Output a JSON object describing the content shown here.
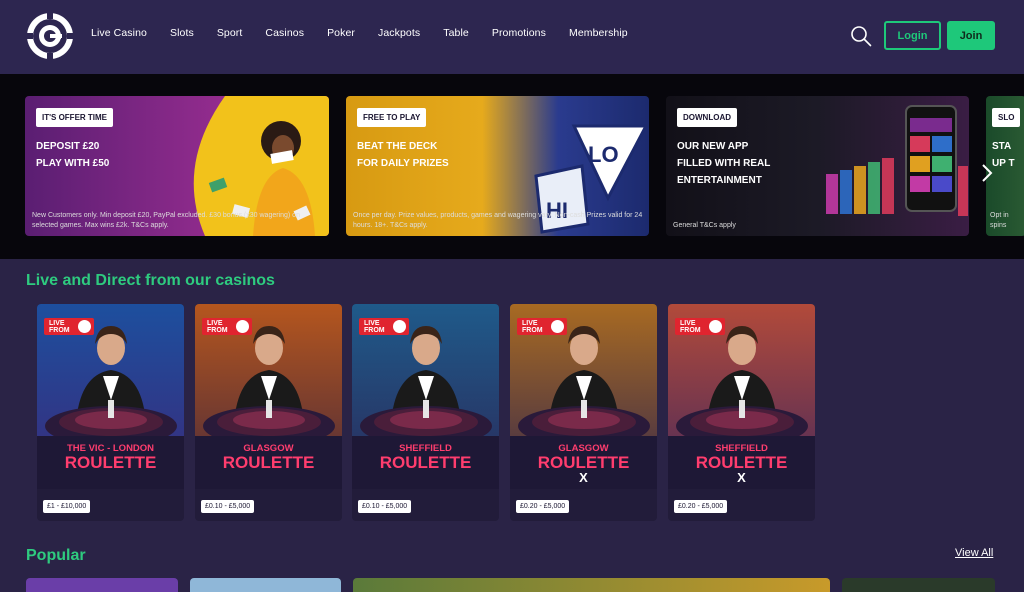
{
  "header": {
    "nav": [
      "Live Casino",
      "Slots",
      "Sport",
      "Casinos",
      "Poker",
      "Jackpots",
      "Table",
      "Promotions",
      "Membership"
    ],
    "login_label": "Login",
    "join_label": "Join",
    "accent": "#1ec87a"
  },
  "promos": [
    {
      "tag": "IT'S OFFER TIME",
      "line1": "DEPOSIT £20",
      "line2": "PLAY WITH £50",
      "terms": "New Customers only. Min deposit £20, PayPal excluded. £30 bonus (x30 wagering) on selected games. Max wins £2k. T&Cs apply."
    },
    {
      "tag": "FREE TO PLAY",
      "line1": "BEAT THE DECK",
      "line2": "FOR DAILY PRIZES",
      "terms": "Once per day. Prize values, products, games and wagering vary. Non-cash Prizes valid for 24 hours. 18+. T&Cs apply.",
      "art_label_hi": "HI",
      "art_label_lo": "LO"
    },
    {
      "tag": "DOWNLOAD",
      "line1": "OUR NEW APP",
      "line2": "FILLED WITH REAL",
      "line3": "ENTERTAINMENT",
      "terms": "General T&Cs apply"
    },
    {
      "tag": "SLO",
      "line1": "STA",
      "line2": "UP T",
      "terms": "Opt in spins"
    }
  ],
  "live": {
    "title": "Live and Direct from our casinos",
    "badge": "LIVE FROM",
    "cards": [
      {
        "city": "THE VIC - LONDON",
        "game": "ROULETTE",
        "x": "",
        "stake": "£1 - £10,000"
      },
      {
        "city": "GLASGOW",
        "game": "ROULETTE",
        "x": "",
        "stake": "£0.10 - £5,000"
      },
      {
        "city": "SHEFFIELD",
        "game": "ROULETTE",
        "x": "",
        "stake": "£0.10 - £5,000"
      },
      {
        "city": "GLASGOW",
        "game": "ROULETTE",
        "x": "X",
        "stake": "£0.20 - £5,000"
      },
      {
        "city": "SHEFFIELD",
        "game": "ROULETTE",
        "x": "X",
        "stake": "£0.20 - £5,000"
      }
    ]
  },
  "popular": {
    "title": "Popular",
    "view_all": "View All"
  }
}
